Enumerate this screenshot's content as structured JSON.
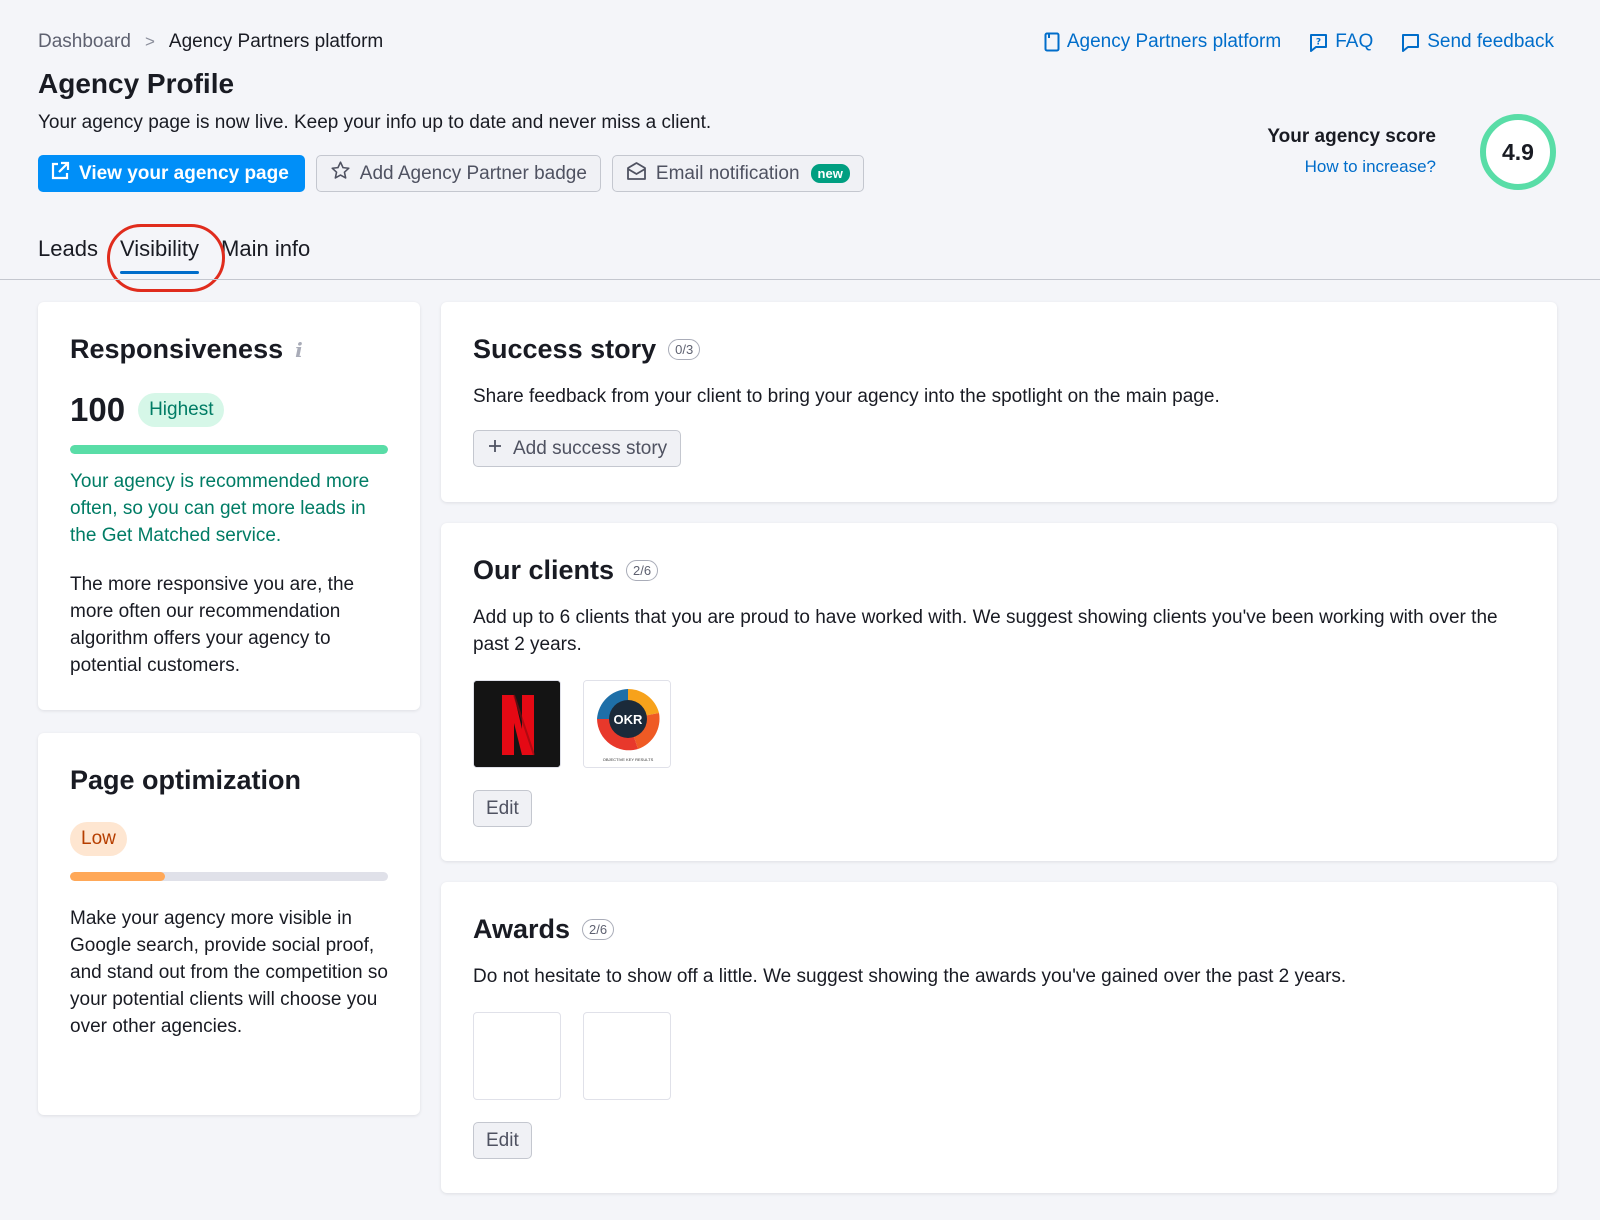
{
  "breadcrumb": {
    "parent": "Dashboard",
    "separator": ">",
    "current": "Agency Partners platform"
  },
  "top_links": [
    {
      "label": "Agency Partners platform",
      "icon": "book-icon"
    },
    {
      "label": "FAQ",
      "icon": "faq-icon"
    },
    {
      "label": "Send feedback",
      "icon": "feedback-icon"
    }
  ],
  "page": {
    "title": "Agency Profile",
    "subtitle": "Your agency page is now live. Keep your info up to date and never miss a client."
  },
  "actions": {
    "view_page": "View your agency page",
    "add_badge": "Add Agency Partner badge",
    "email_notification": "Email notification",
    "new_badge": "new"
  },
  "score": {
    "label": "Your agency score",
    "link": "How to increase?",
    "value": "4.9"
  },
  "tabs": [
    {
      "label": "Leads",
      "active": false
    },
    {
      "label": "Visibility",
      "active": true
    },
    {
      "label": "Main info",
      "active": false
    }
  ],
  "responsiveness": {
    "title": "Responsiveness",
    "info_icon": "i",
    "value": "100",
    "level": "Highest",
    "progress": 1.0,
    "highlight": "Your agency is recommended more often, so you can get more leads in the Get Matched service.",
    "body": "The more responsive you are, the more often our recommendation algorithm offers your agency to potential customers."
  },
  "optimization": {
    "title": "Page optimization",
    "level": "Low",
    "progress": 0.3,
    "body": "Make your agency more visible in Google search, provide social proof, and stand out from the competition so your potential clients will choose you over other agencies."
  },
  "success_story": {
    "title": "Success story",
    "counter": "0/3",
    "description": "Share feedback from your client to bring your agency into the spotlight on the main page.",
    "button": "Add success story"
  },
  "clients": {
    "title": "Our clients",
    "counter": "2/6",
    "description": "Add up to 6 clients that you are proud to have worked with. We suggest showing clients you've been working with over the past 2 years.",
    "logos": [
      {
        "name": "netflix-logo",
        "letter": "N"
      },
      {
        "name": "okr-logo",
        "text": "OKR",
        "caption": "OBJECTIVE KEY RESULTS"
      }
    ],
    "edit": "Edit"
  },
  "awards": {
    "title": "Awards",
    "counter": "2/6",
    "description": "Do not hesitate to show off a little. We suggest showing the awards you've gained over the past 2 years.",
    "edit": "Edit"
  },
  "colors": {
    "primary": "#008ff8",
    "link": "#006dca",
    "green": "#59dda7",
    "orange": "#ffa858",
    "highlight_circle": "#e02c1d"
  }
}
